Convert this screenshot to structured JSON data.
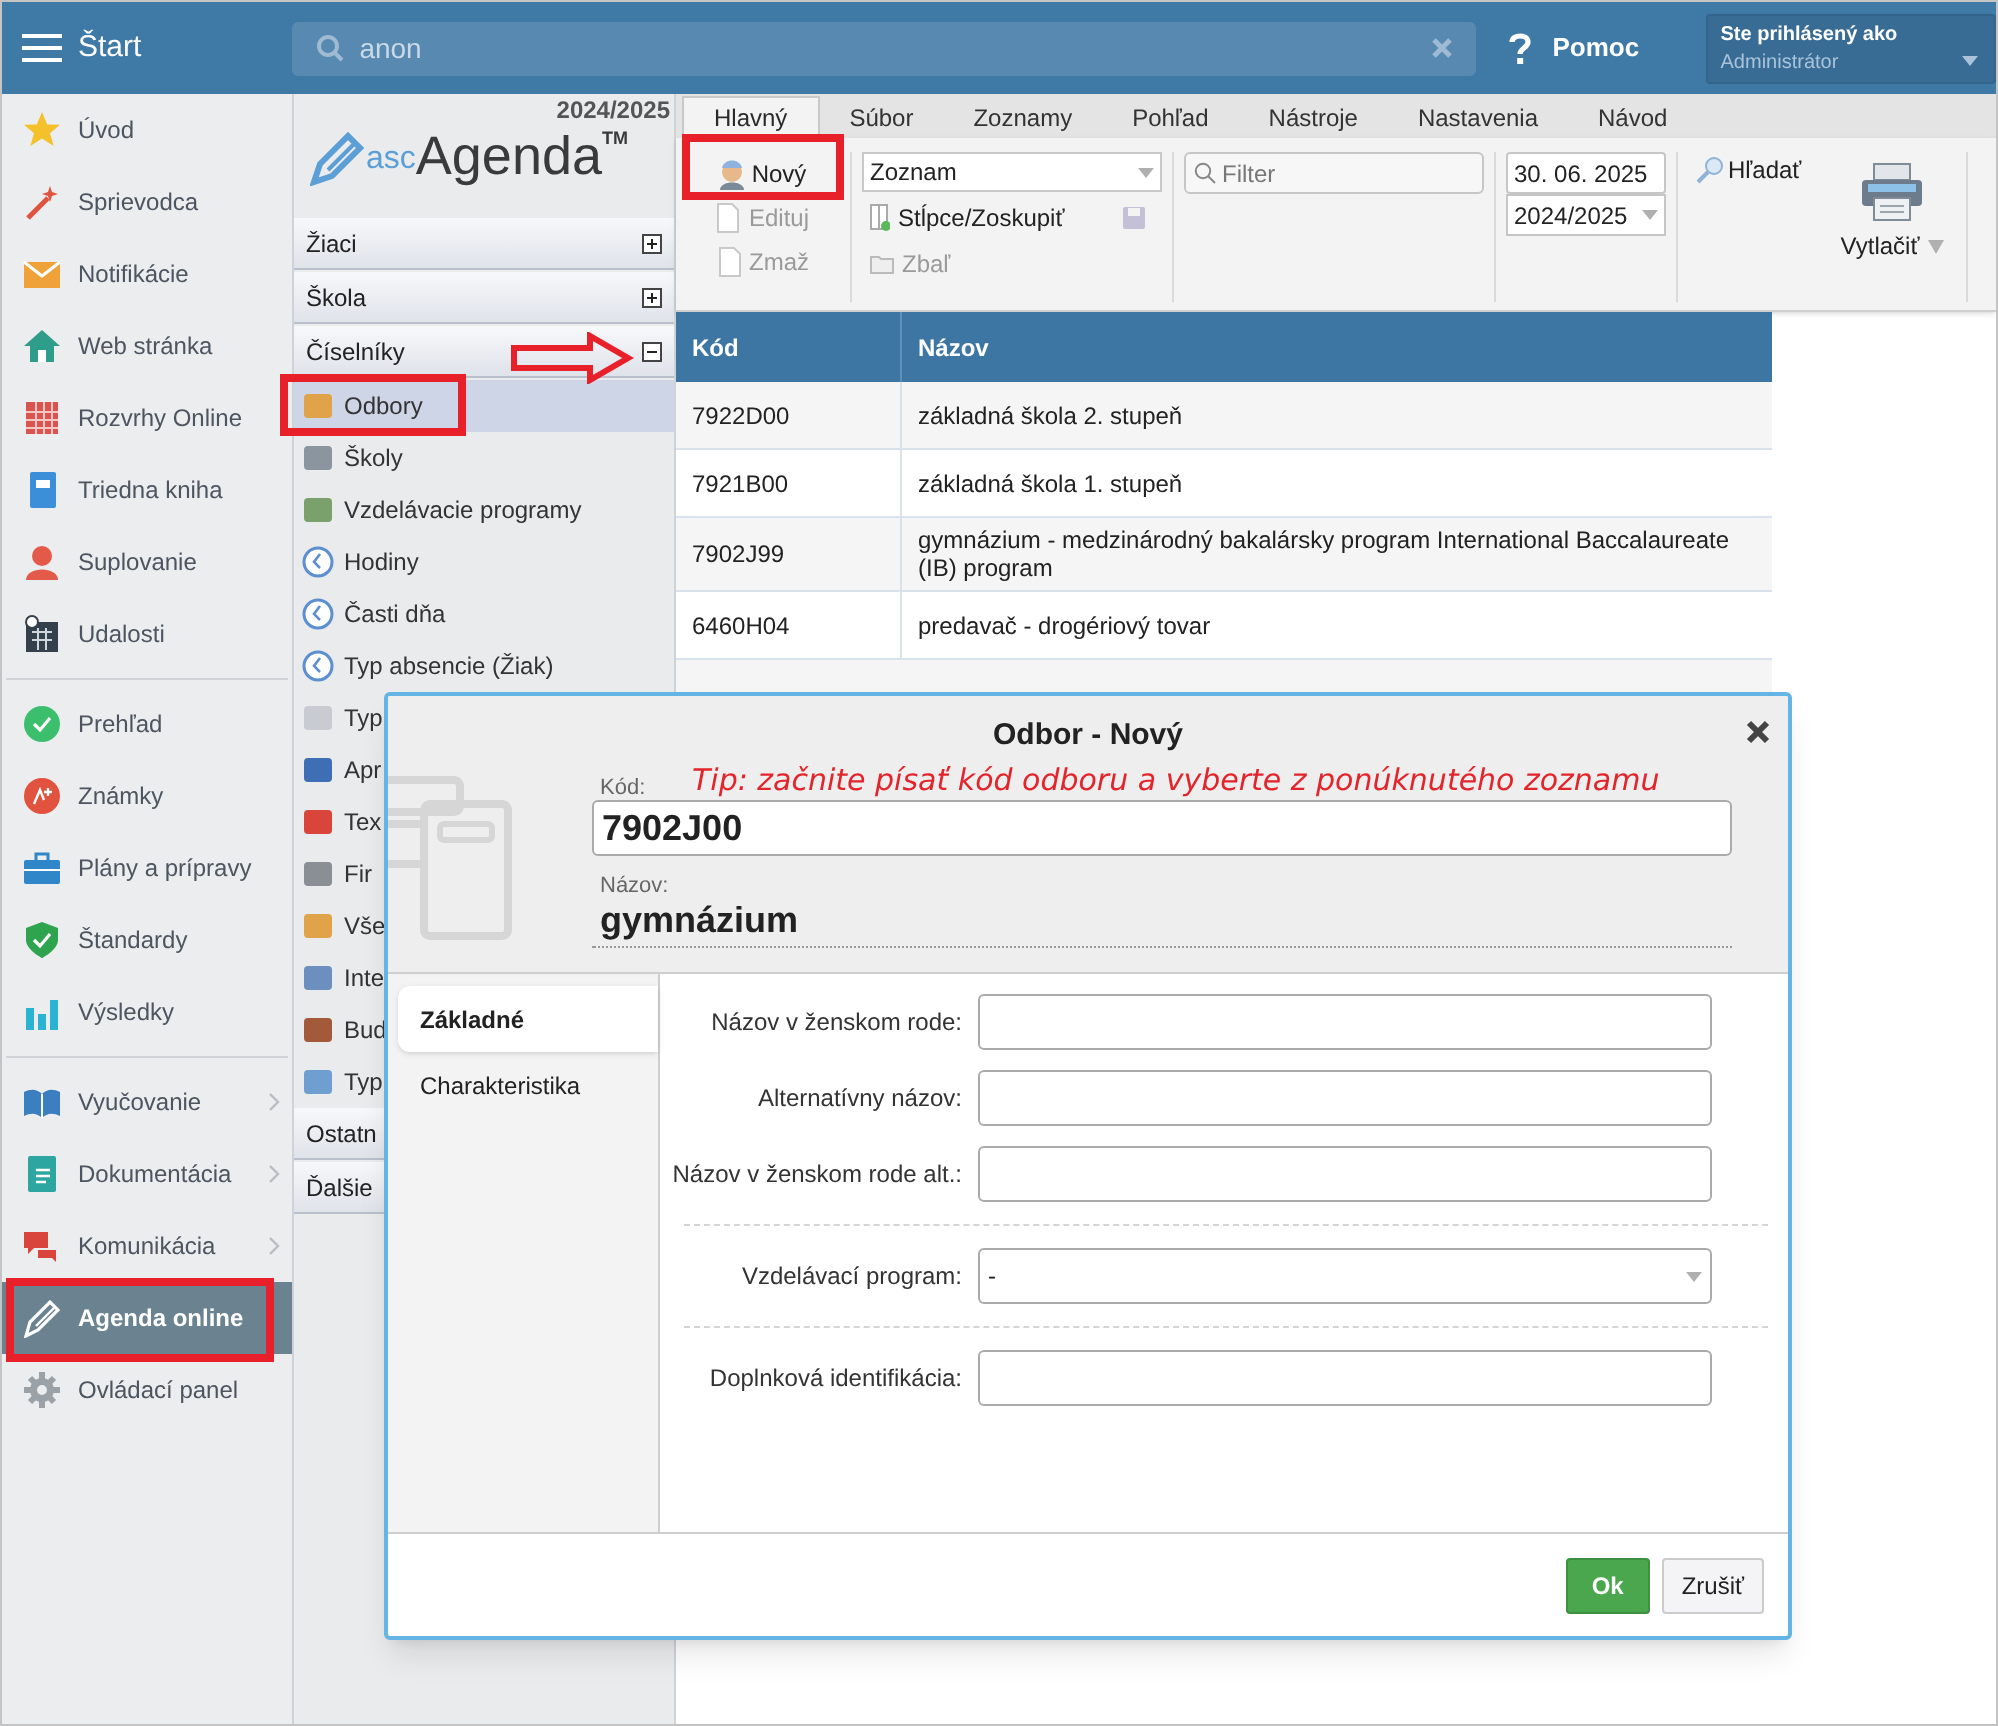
{
  "top_bar": {
    "menu_label": "Štart",
    "search": {
      "value": "anon"
    },
    "help": "Pomoc",
    "user": {
      "caption": "Ste prihlásený ako",
      "name": "Administrátor"
    }
  },
  "sidebar": {
    "groups": [
      [
        {
          "label": "Úvod",
          "selected": false,
          "submenu": false
        },
        {
          "label": "Sprievodca",
          "selected": false,
          "submenu": false
        },
        {
          "label": "Notifikácie",
          "selected": false,
          "submenu": false
        },
        {
          "label": "Web stránka",
          "selected": false,
          "submenu": false
        },
        {
          "label": "Rozvrhy Online",
          "selected": false,
          "submenu": false
        },
        {
          "label": "Triedna kniha",
          "selected": false,
          "submenu": false
        },
        {
          "label": "Suplovanie",
          "selected": false,
          "submenu": false
        },
        {
          "label": "Udalosti",
          "selected": false,
          "submenu": false
        }
      ],
      [
        {
          "label": "Prehľad",
          "selected": false,
          "submenu": false
        },
        {
          "label": "Známky",
          "selected": false,
          "submenu": false
        },
        {
          "label": "Plány a prípravy",
          "selected": false,
          "submenu": false
        },
        {
          "label": "Štandardy",
          "selected": false,
          "submenu": false
        },
        {
          "label": "Výsledky",
          "selected": false,
          "submenu": false
        }
      ],
      [
        {
          "label": "Vyučovanie",
          "selected": false,
          "submenu": true
        },
        {
          "label": "Dokumentácia",
          "selected": false,
          "submenu": true
        },
        {
          "label": "Komunikácia",
          "selected": false,
          "submenu": true
        },
        {
          "label": "Agenda online",
          "selected": true,
          "submenu": false
        },
        {
          "label": "Ovládací panel",
          "selected": false,
          "submenu": false
        }
      ]
    ]
  },
  "module_panel": {
    "year": "2024/2025",
    "logo": {
      "prefix": "asc",
      "name": "Agenda",
      "mark": "TM"
    },
    "sections": [
      {
        "label": "Žiaci",
        "expanded": false
      },
      {
        "label": "Škola",
        "expanded": false
      },
      {
        "label": "Číselníky",
        "expanded": true,
        "items": [
          {
            "label": "Odbory",
            "selected": true
          },
          {
            "label": "Školy",
            "selected": false
          },
          {
            "label": "Vzdelávacie programy",
            "selected": false
          },
          {
            "label": "Hodiny",
            "selected": false
          },
          {
            "label": "Časti dňa",
            "selected": false
          },
          {
            "label": "Typ absencie (Žiak)",
            "selected": false
          },
          {
            "label": "Typ",
            "selected": false
          },
          {
            "label": "Apr",
            "selected": false
          },
          {
            "label": "Tex",
            "selected": false
          },
          {
            "label": "Fir",
            "selected": false
          },
          {
            "label": "Vše",
            "selected": false
          },
          {
            "label": "Inte",
            "selected": false
          },
          {
            "label": "Bud",
            "selected": false
          },
          {
            "label": "Typ",
            "selected": false
          }
        ]
      },
      {
        "label": "Ostatn"
      },
      {
        "label": "Ďalšie"
      }
    ]
  },
  "ribbon": {
    "tabs": [
      {
        "label": "Hlavný",
        "selected": true
      },
      {
        "label": "Súbor",
        "selected": false
      },
      {
        "label": "Zoznamy",
        "selected": false
      },
      {
        "label": "Pohľad",
        "selected": false
      },
      {
        "label": "Nástroje",
        "selected": false
      },
      {
        "label": "Nastavenia",
        "selected": false
      },
      {
        "label": "Návod",
        "selected": false
      }
    ],
    "record_buttons": [
      {
        "label": "Nový",
        "disabled": false
      },
      {
        "label": "Edituj",
        "disabled": true
      },
      {
        "label": "Zmaž",
        "disabled": true
      }
    ],
    "view_select": {
      "value": "Zoznam"
    },
    "columns_button": {
      "label": "Stĺpce/Zoskupiť"
    },
    "collapse_button": {
      "label": "Zbaľ",
      "disabled": true
    },
    "filter": {
      "placeholder": "Filter"
    },
    "date": {
      "value": "30. 06. 2025"
    },
    "year_select": {
      "value": "2024/2025"
    },
    "search_button": {
      "label": "Hľadať"
    },
    "print_button": {
      "label": "Vytlačiť"
    }
  },
  "table": {
    "columns": [
      "Kód",
      "Názov"
    ],
    "rows": [
      [
        "7922D00",
        "základná škola 2. stupeň"
      ],
      [
        "7921B00",
        "základná škola 1. stupeň"
      ],
      [
        "7902J99",
        "gymnázium - medzinárodný bakalársky program International Baccalaureate (IB) program"
      ],
      [
        "6460H04",
        "predavač - drogériový tovar"
      ]
    ]
  },
  "dialog": {
    "title": "Odbor - Nový",
    "tip": "Tip: začnite písať kód odboru a vyberte z ponúknutého zoznamu",
    "code": {
      "label": "Kód:",
      "value": "7902J00"
    },
    "name": {
      "label": "Názov:",
      "value": "gymnázium"
    },
    "tabs": [
      {
        "label": "Základné",
        "selected": true
      },
      {
        "label": "Charakteristika",
        "selected": false
      }
    ],
    "field_groups": [
      [
        {
          "label": "Názov v ženskom rode:",
          "kind": "text"
        },
        {
          "label": "Alternatívny názov:",
          "kind": "text"
        },
        {
          "label": "Názov v ženskom rode alt.:",
          "kind": "text"
        }
      ],
      [
        {
          "label": "Vzdelávací program:",
          "kind": "select",
          "value": "-"
        }
      ],
      [
        {
          "label": "Doplnková identifikácia:",
          "kind": "text"
        }
      ]
    ],
    "ok": "Ok",
    "cancel": "Zrušiť"
  }
}
